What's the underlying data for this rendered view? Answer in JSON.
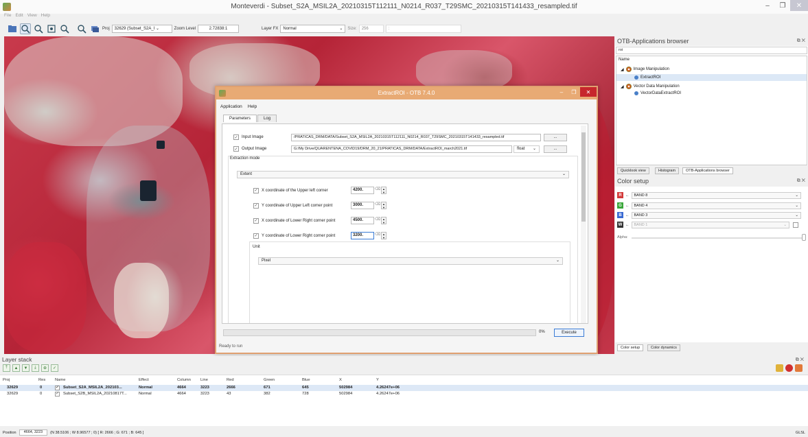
{
  "window": {
    "title": "Monteverdi - Subset_S2A_MSIL2A_20210315T112111_N0214_R037_T29SMC_20210315T141433_resampled.tif"
  },
  "menu": [
    "File",
    "Edit",
    "View",
    "Help"
  ],
  "toolbar": {
    "proj_label": "Proj",
    "proj_value": "32629 (Subset_S2A_I",
    "zoom_label": "Zoom Level",
    "zoom_value": "2.72838:1",
    "layer_fx_label": "Layer FX",
    "layer_fx_value": "Normal",
    "size_label": "Size:",
    "size_value": "256",
    "aux_value": ":"
  },
  "dialog": {
    "title": "ExtractROI - OTB 7.4.0",
    "menu": [
      "Application",
      "Help"
    ],
    "tabs": [
      "Parameters",
      "Log"
    ],
    "input_image_label": "Input Image",
    "input_image_value": "/PRATICAS_DRM/DATA/Subset_S2A_MSIL2A_20210315T112111_N0214_R037_T29SMC_20210315T141433_resampled.tif",
    "output_image_label": "Output Image",
    "output_image_value": "G:/My Drive/QUARENTENA_COVID19/DRM_20_21/PRATICAS_DRM/DATA/ExtractROI_march2021.tif",
    "output_type": "float",
    "browse": "...",
    "extraction_mode_label": "Extraction mode",
    "extraction_mode_value": "Extent",
    "params": [
      {
        "label": "X coordinate of the Upper left corner",
        "value": "4200."
      },
      {
        "label": "Y coordinate of Upper Left corner point",
        "value": "3000."
      },
      {
        "label": "X coordinate of Lower Right corner point",
        "value": "4500."
      },
      {
        "label": "Y coordinate of Lower Right corner point",
        "value": "3200."
      }
    ],
    "unit_label": "Unit",
    "unit_value": "Pixel",
    "progress_pct": "0%",
    "progress_fraction": 0,
    "execute": "Execute",
    "status": "Ready to run"
  },
  "otb_browser": {
    "title": "OTB-Applications browser",
    "search": "roi",
    "column": "Name",
    "tree": [
      {
        "label": "Image Manipulation",
        "child": "ExtractROI"
      },
      {
        "label": "Vector Data Manipulation",
        "child": "VectorDataExtractROI"
      }
    ],
    "tabs": [
      "Quicklook view",
      "Histogram",
      "OTB-Applications browser"
    ]
  },
  "color_setup": {
    "title": "Color setup",
    "bands": [
      {
        "channel": "R",
        "color": "#d23a3a",
        "band": "BAND 8"
      },
      {
        "channel": "G",
        "color": "#3aa63a",
        "band": "BAND 4"
      },
      {
        "channel": "B",
        "color": "#3a6ad2",
        "band": "BAND 3"
      },
      {
        "channel": "W",
        "color": "#333333",
        "band": "BAND 1"
      }
    ],
    "alpha_label": "Alpha:",
    "tabs": [
      "Color setup",
      "Color dynamics"
    ]
  },
  "layer_stack": {
    "title": "Layer stack",
    "columns": [
      "Proj",
      "Res",
      "Name",
      "Effect",
      "Column",
      "Line",
      "Red",
      "Green",
      "Blue",
      "X",
      "Y"
    ],
    "rows": [
      {
        "proj": "32629",
        "res": "0",
        "name": "Subset_S2A_MSIL2A_202103...",
        "effect": "Normal",
        "column": "4664",
        "line": "3223",
        "red": "2666",
        "green": "671",
        "blue": "645",
        "x": "502984",
        "y": "4.26247e+06"
      },
      {
        "proj": "32629",
        "res": "0",
        "name": "Subset_S2B_MSIL2A_20210817T...",
        "effect": "Normal",
        "column": "4664",
        "line": "3223",
        "red": "43",
        "green": "382",
        "blue": "728",
        "x": "502984",
        "y": "4.26247e+06"
      }
    ]
  },
  "statusbar": {
    "position_label": "Position",
    "position_value": "4664, 3223",
    "info": "(N 38.5106 ; W 8.96577 ; 0) [ R: 2666 ; G: 671 ; B: 645 ]",
    "glsl": "GLSL"
  }
}
